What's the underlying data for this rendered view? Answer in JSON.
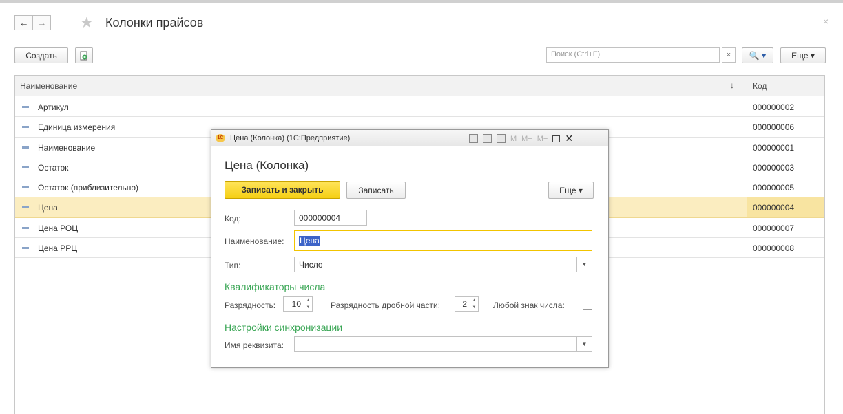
{
  "window": {
    "title": "Колонки прайсов",
    "close": "×"
  },
  "nav": {
    "back": "←",
    "forward": "→"
  },
  "toolbar": {
    "create_label": "Создать",
    "search_placeholder": "Поиск (Ctrl+F)",
    "search_clear": "×",
    "search_btn": "🔍 ▾",
    "more_label": "Еще ▾"
  },
  "table": {
    "columns": {
      "name": "Наименование",
      "sort": "↓",
      "code": "Код"
    },
    "rows": [
      {
        "name": "Артикул",
        "code": "000000002"
      },
      {
        "name": "Единица измерения",
        "code": "000000006"
      },
      {
        "name": "Наименование",
        "code": "000000001"
      },
      {
        "name": "Остаток",
        "code": "000000003"
      },
      {
        "name": "Остаток (приблизительно)",
        "code": "000000005"
      },
      {
        "name": "Цена",
        "code": "000000004"
      },
      {
        "name": "Цена РОЦ",
        "code": "000000007"
      },
      {
        "name": "Цена РРЦ",
        "code": "000000008"
      }
    ],
    "selected_row": 5
  },
  "dialog": {
    "window_title": "Цена (Колонка)  (1С:Предприятие)",
    "logo": "1С",
    "title_icons": {
      "m": "M",
      "m_plus": "M+",
      "m_minus": "M−",
      "close": "✕"
    },
    "heading": "Цена (Колонка)",
    "save_close_label": "Записать и закрыть",
    "save_label": "Записать",
    "more_label": "Еще ▾",
    "code_label": "Код:",
    "code_value": "000000004",
    "name_label": "Наименование:",
    "name_value": "Цена",
    "type_label": "Тип:",
    "type_value": "Число",
    "section_number": "Квалификаторы числа",
    "digits_label": "Разрядность:",
    "digits_value": "10",
    "fraction_label": "Разрядность дробной части:",
    "fraction_value": "2",
    "any_sign_label": "Любой знак числа:",
    "any_sign_checked": false,
    "section_sync": "Настройки синхронизации",
    "attr_label": "Имя реквизита:",
    "attr_value": ""
  },
  "colors": {
    "accent": "#f5cf14",
    "selected_row": "#fbedc0",
    "section": "#3aa655",
    "selection": "#3c63c8"
  }
}
